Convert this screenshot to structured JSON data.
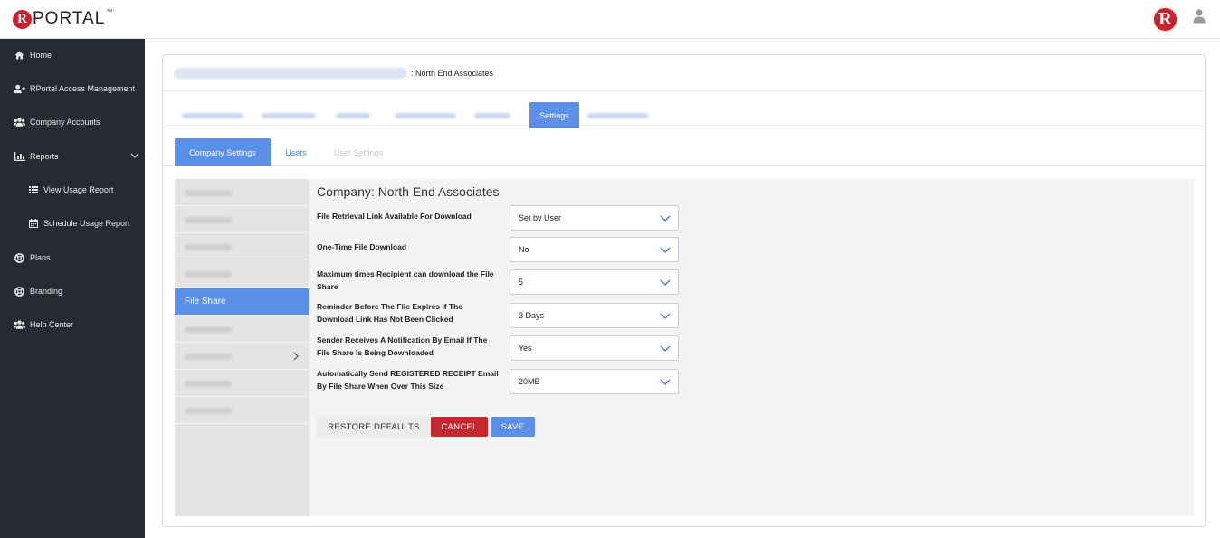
{
  "app": {
    "logo_letter": "R",
    "logo_text": "PORTAL",
    "logo_tm": "™",
    "badge_letter": "R",
    "accent": "#5b8fe8",
    "danger": "#c6262e",
    "sidebar_bg": "#262b33"
  },
  "sidebar": {
    "items": [
      {
        "label": "Home",
        "icon": "home-icon"
      },
      {
        "label": "RPortal Access Management",
        "icon": "user-plus-icon"
      },
      {
        "label": "Company Accounts",
        "icon": "users-icon"
      },
      {
        "label": "Reports",
        "icon": "bar-chart-icon"
      },
      {
        "label": "View Usage Report",
        "icon": "list-icon"
      },
      {
        "label": "Schedule Usage Report",
        "icon": "calendar-icon"
      },
      {
        "label": "Plans",
        "icon": "lifebuoy-icon"
      },
      {
        "label": "Branding",
        "icon": "lifebuoy-icon"
      },
      {
        "label": "Help Center",
        "icon": "users-icon"
      }
    ]
  },
  "header": {
    "suffix": ": North End Associates"
  },
  "primary_tabs": {
    "active_label": "Settings"
  },
  "secondary_tabs": [
    {
      "label": "Company Settings"
    },
    {
      "label": "Users"
    },
    {
      "label": "User Settings"
    }
  ],
  "submenu": {
    "active_label": "File Share"
  },
  "form": {
    "title": "Company: North End Associates",
    "rows": [
      {
        "label": "File Retrieval Link Available For Download",
        "value": "Set by User"
      },
      {
        "label": "One-Time File Download",
        "value": "No"
      },
      {
        "label": "Maximum times Recipient can download the File Share",
        "value": "5"
      },
      {
        "label": "Reminder Before The File Expires If The Download Link Has Not Been Clicked",
        "value": "3 Days"
      },
      {
        "label": "Sender Receives A Notification By Email If The File Share Is Being Downloaded",
        "value": "Yes"
      },
      {
        "label": "Automatically Send REGISTERED RECEIPT Email By File Share When Over This Size",
        "value": "20MB"
      }
    ]
  },
  "buttons": {
    "restore": "RESTORE DEFAULTS",
    "cancel": "CANCEL",
    "save": "SAVE"
  }
}
